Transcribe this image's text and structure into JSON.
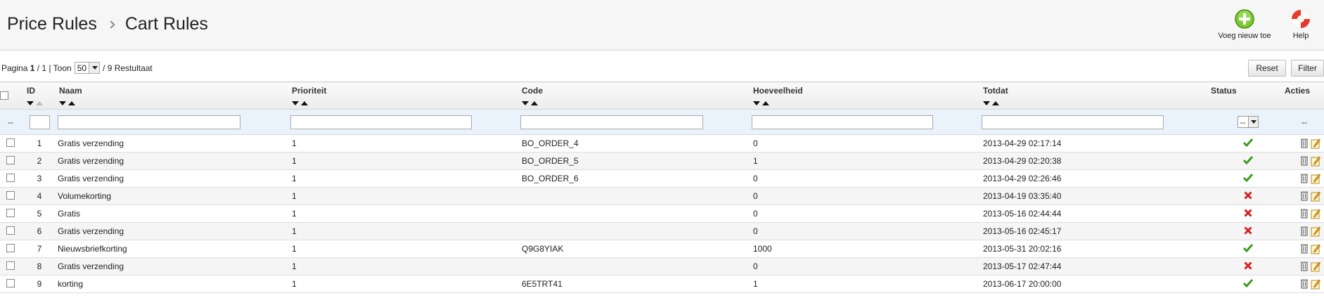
{
  "breadcrumb": {
    "parent": "Price Rules",
    "current": "Cart Rules"
  },
  "toolbar": {
    "add_label": "Voeg nieuw toe",
    "help_label": "Help"
  },
  "paging": {
    "prefix": "Pagina",
    "page": "1",
    "of": "/ 1 | Toon",
    "per_page": "50",
    "results": "/ 9 Restultaat"
  },
  "buttons": {
    "reset": "Reset",
    "filter": "Filter"
  },
  "columns": {
    "id": "ID",
    "name": "Naam",
    "priority": "Prioriteit",
    "code": "Code",
    "quantity": "Hoeveelheid",
    "until": "Totdat",
    "status": "Status",
    "actions": "Acties"
  },
  "filter": {
    "first": "--",
    "status_value": "--",
    "actions": "--"
  },
  "colors": {
    "accent_green": "#3c9b1e",
    "error_red": "#d42121"
  },
  "rows": [
    {
      "id": "1",
      "name": "Gratis verzending",
      "priority": "1",
      "code": "BO_ORDER_4",
      "quantity": "0",
      "until": "2013-04-29 02:17:14",
      "active": true
    },
    {
      "id": "2",
      "name": "Gratis verzending",
      "priority": "1",
      "code": "BO_ORDER_5",
      "quantity": "1",
      "until": "2013-04-29 02:20:38",
      "active": true
    },
    {
      "id": "3",
      "name": "Gratis verzending",
      "priority": "1",
      "code": "BO_ORDER_6",
      "quantity": "0",
      "until": "2013-04-29 02:26:46",
      "active": true
    },
    {
      "id": "4",
      "name": "Volumekorting",
      "priority": "1",
      "code": "",
      "quantity": "0",
      "until": "2013-04-19 03:35:40",
      "active": false
    },
    {
      "id": "5",
      "name": "Gratis",
      "priority": "1",
      "code": "",
      "quantity": "0",
      "until": "2013-05-16 02:44:44",
      "active": false
    },
    {
      "id": "6",
      "name": "Gratis verzending",
      "priority": "1",
      "code": "",
      "quantity": "0",
      "until": "2013-05-16 02:45:17",
      "active": false
    },
    {
      "id": "7",
      "name": "Nieuwsbriefkorting",
      "priority": "1",
      "code": "Q9G8YIAK",
      "quantity": "1000",
      "until": "2013-05-31 20:02:16",
      "active": true
    },
    {
      "id": "8",
      "name": "Gratis verzending",
      "priority": "1",
      "code": "",
      "quantity": "0",
      "until": "2013-05-17 02:47:44",
      "active": false
    },
    {
      "id": "9",
      "name": "korting",
      "priority": "1",
      "code": "6E5TRT41",
      "quantity": "1",
      "until": "2013-06-17 20:00:00",
      "active": true
    }
  ]
}
